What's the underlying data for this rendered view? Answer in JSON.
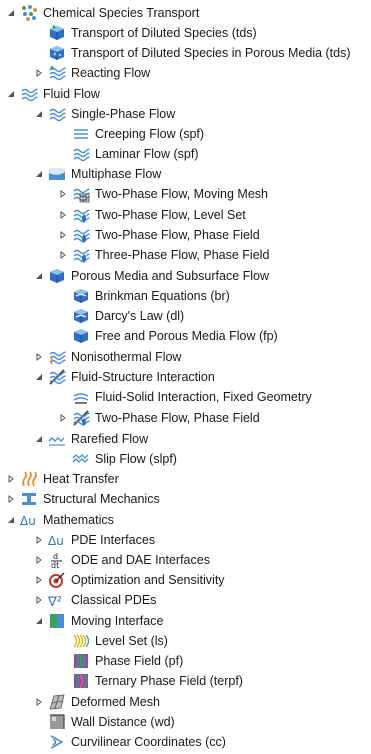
{
  "tree": {
    "items": [
      {
        "label": "Chemical Species Transport",
        "icon": "chemical-species-icon",
        "toggle": "expanded"
      },
      {
        "label": "Transport of Diluted Species (tds)",
        "icon": "diluted-species-icon",
        "toggle": "none"
      },
      {
        "label": "Transport of Diluted Species in Porous Media (tds)",
        "icon": "porous-diluted-species-icon",
        "toggle": "none"
      },
      {
        "label": "Reacting Flow",
        "icon": "reacting-flow-icon",
        "toggle": "collapsed"
      },
      {
        "label": "Fluid Flow",
        "icon": "fluid-flow-icon",
        "toggle": "expanded"
      },
      {
        "label": "Single-Phase Flow",
        "icon": "single-phase-flow-icon",
        "toggle": "expanded"
      },
      {
        "label": "Creeping Flow (spf)",
        "icon": "creeping-flow-icon",
        "toggle": "none"
      },
      {
        "label": "Laminar Flow (spf)",
        "icon": "laminar-flow-icon",
        "toggle": "none"
      },
      {
        "label": "Multiphase Flow",
        "icon": "multiphase-flow-icon",
        "toggle": "expanded"
      },
      {
        "label": "Two-Phase Flow, Moving Mesh",
        "icon": "moving-mesh-flow-icon",
        "toggle": "collapsed"
      },
      {
        "label": "Two-Phase Flow, Level Set",
        "icon": "level-set-flow-icon",
        "toggle": "collapsed"
      },
      {
        "label": "Two-Phase Flow, Phase Field",
        "icon": "phase-field-flow-icon",
        "toggle": "collapsed"
      },
      {
        "label": "Three-Phase Flow, Phase Field",
        "icon": "three-phase-flow-icon",
        "toggle": "collapsed"
      },
      {
        "label": "Porous Media and Subsurface Flow",
        "icon": "porous-media-icon",
        "toggle": "expanded"
      },
      {
        "label": "Brinkman Equations (br)",
        "icon": "brinkman-icon",
        "toggle": "none"
      },
      {
        "label": "Darcy's Law (dl)",
        "icon": "darcys-law-icon",
        "toggle": "none"
      },
      {
        "label": "Free and Porous Media Flow (fp)",
        "icon": "free-porous-flow-icon",
        "toggle": "none"
      },
      {
        "label": "Nonisothermal Flow",
        "icon": "nonisothermal-flow-icon",
        "toggle": "collapsed"
      },
      {
        "label": "Fluid-Structure Interaction",
        "icon": "fluid-structure-icon",
        "toggle": "expanded"
      },
      {
        "label": "Fluid-Solid Interaction, Fixed Geometry",
        "icon": "fluid-solid-icon",
        "toggle": "none"
      },
      {
        "label": "Two-Phase Flow, Phase Field",
        "icon": "fsi-phase-field-icon",
        "toggle": "collapsed"
      },
      {
        "label": "Rarefied Flow",
        "icon": "rarefied-flow-icon",
        "toggle": "expanded"
      },
      {
        "label": "Slip Flow (slpf)",
        "icon": "slip-flow-icon",
        "toggle": "none"
      },
      {
        "label": "Heat Transfer",
        "icon": "heat-transfer-icon",
        "toggle": "collapsed"
      },
      {
        "label": "Structural Mechanics",
        "icon": "structural-mechanics-icon",
        "toggle": "collapsed"
      },
      {
        "label": "Mathematics",
        "icon": "mathematics-icon",
        "toggle": "expanded"
      },
      {
        "label": "PDE Interfaces",
        "icon": "pde-interfaces-icon",
        "toggle": "collapsed"
      },
      {
        "label": "ODE and DAE Interfaces",
        "icon": "ode-dae-icon",
        "toggle": "collapsed"
      },
      {
        "label": "Optimization and Sensitivity",
        "icon": "optimization-icon",
        "toggle": "collapsed"
      },
      {
        "label": "Classical PDEs",
        "icon": "classical-pdes-icon",
        "toggle": "collapsed"
      },
      {
        "label": "Moving Interface",
        "icon": "moving-interface-icon",
        "toggle": "expanded"
      },
      {
        "label": "Level Set (ls)",
        "icon": "level-set-icon",
        "toggle": "none"
      },
      {
        "label": "Phase Field (pf)",
        "icon": "phase-field-icon",
        "toggle": "none"
      },
      {
        "label": "Ternary Phase Field (terpf)",
        "icon": "ternary-phase-field-icon",
        "toggle": "none"
      },
      {
        "label": "Deformed Mesh",
        "icon": "deformed-mesh-icon",
        "toggle": "collapsed"
      },
      {
        "label": "Wall Distance (wd)",
        "icon": "wall-distance-icon",
        "toggle": "none"
      },
      {
        "label": "Curvilinear Coordinates (cc)",
        "icon": "curvilinear-coordinates-icon",
        "toggle": "none"
      }
    ]
  },
  "colors": {
    "flow_blue": "#4a90d9",
    "porous_blue": "#2f6fc4",
    "heat_orange": "#e8892a",
    "math_blue": "#3b6ec2",
    "toggle_gray": "#555555",
    "phase_green": "#3aa35a",
    "phase_purple": "#8a4bb5"
  }
}
